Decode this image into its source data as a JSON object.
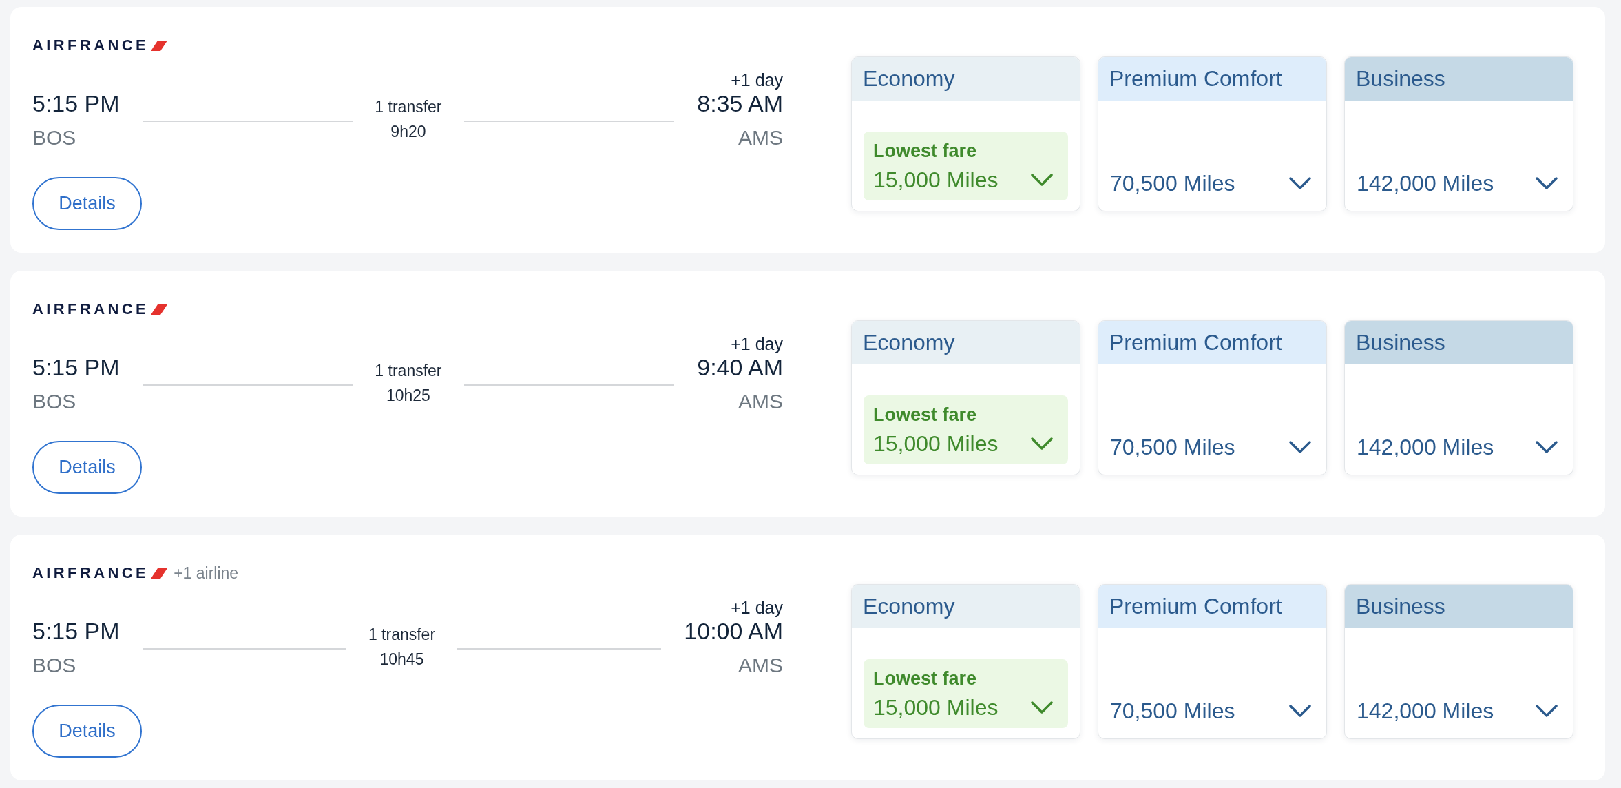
{
  "flights": [
    {
      "airline": {
        "name": "AIRFRANCE"
      },
      "departure": {
        "time": "5:15 PM",
        "airport": "BOS"
      },
      "stops": "1 transfer",
      "duration": "9h20",
      "arrival": {
        "day_offset": "+1 day",
        "time": "8:35 AM",
        "airport": "AMS"
      },
      "details_button": "Details",
      "fares": [
        {
          "cabin": "Economy",
          "color": "#e8f0f4",
          "kind": "lowest",
          "badge": "Lowest fare",
          "price": "15,000 Miles"
        },
        {
          "cabin": "Premium Comfort",
          "color": "#deedfb",
          "kind": "standard",
          "price": "70,500 Miles"
        },
        {
          "cabin": "Business",
          "color": "#c5d9e6",
          "kind": "standard",
          "price": "142,000 Miles"
        }
      ]
    },
    {
      "airline": {
        "name": "AIRFRANCE"
      },
      "departure": {
        "time": "5:15 PM",
        "airport": "BOS"
      },
      "stops": "1 transfer",
      "duration": "10h25",
      "arrival": {
        "day_offset": "+1 day",
        "time": "9:40 AM",
        "airport": "AMS"
      },
      "details_button": "Details",
      "fares": [
        {
          "cabin": "Economy",
          "color": "#e8f0f4",
          "kind": "lowest",
          "badge": "Lowest fare",
          "price": "15,000 Miles"
        },
        {
          "cabin": "Premium Comfort",
          "color": "#deedfb",
          "kind": "standard",
          "price": "70,500 Miles"
        },
        {
          "cabin": "Business",
          "color": "#c5d9e6",
          "kind": "standard",
          "price": "142,000 Miles"
        }
      ]
    },
    {
      "airline": {
        "name": "AIRFRANCE",
        "extra": "+1 airline"
      },
      "departure": {
        "time": "5:15 PM",
        "airport": "BOS"
      },
      "stops": "1 transfer",
      "duration": "10h45",
      "arrival": {
        "day_offset": "+1 day",
        "time": "10:00 AM",
        "airport": "AMS"
      },
      "details_button": "Details",
      "fares": [
        {
          "cabin": "Economy",
          "color": "#e8f0f4",
          "kind": "lowest",
          "badge": "Lowest fare",
          "price": "15,000 Miles"
        },
        {
          "cabin": "Premium Comfort",
          "color": "#deedfb",
          "kind": "standard",
          "price": "70,500 Miles"
        },
        {
          "cabin": "Business",
          "color": "#c5d9e6",
          "kind": "standard",
          "price": "142,000 Miles"
        }
      ]
    }
  ]
}
